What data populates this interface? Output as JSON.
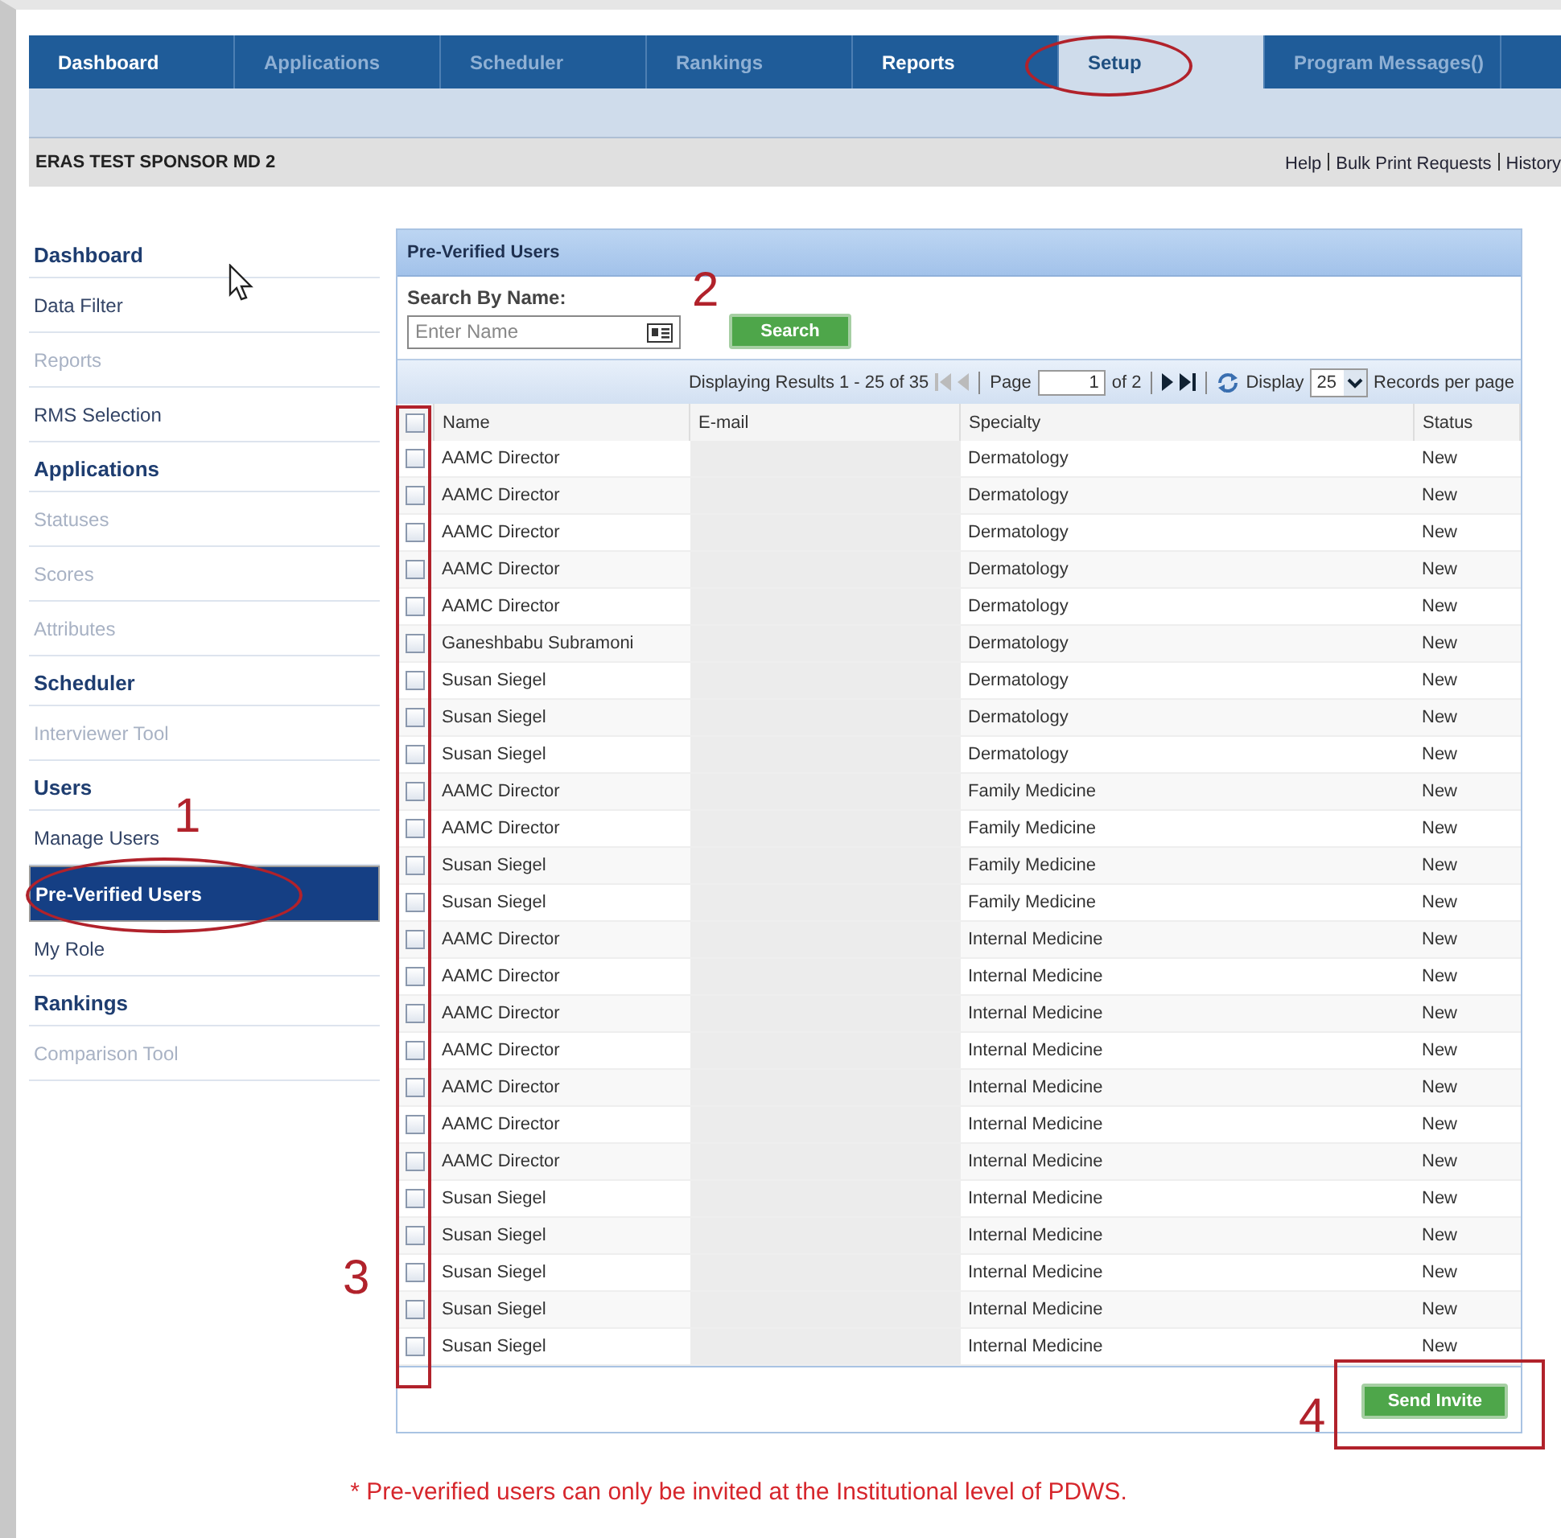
{
  "nav_tabs": [
    {
      "label": "Dashboard",
      "selected": false,
      "disabled": false
    },
    {
      "label": "Applications",
      "selected": false,
      "disabled": true
    },
    {
      "label": "Scheduler",
      "selected": false,
      "disabled": true
    },
    {
      "label": "Rankings",
      "selected": false,
      "disabled": true
    },
    {
      "label": "Reports",
      "selected": false,
      "disabled": false
    },
    {
      "label": "Setup",
      "selected": true,
      "disabled": false
    },
    {
      "label": "Program Messages()",
      "selected": false,
      "disabled": true
    }
  ],
  "account_bar": {
    "sponsor": "ERAS TEST SPONSOR MD 2",
    "links": [
      "Help",
      "Bulk Print Requests",
      "History"
    ]
  },
  "sidebar": [
    {
      "kind": "heading",
      "label": "Dashboard"
    },
    {
      "kind": "item",
      "label": "Data Filter",
      "disabled": false,
      "selected": false
    },
    {
      "kind": "item",
      "label": "Reports",
      "disabled": true,
      "selected": false
    },
    {
      "kind": "item",
      "label": "RMS Selection",
      "disabled": false,
      "selected": false
    },
    {
      "kind": "heading",
      "label": "Applications"
    },
    {
      "kind": "item",
      "label": "Statuses",
      "disabled": true,
      "selected": false
    },
    {
      "kind": "item",
      "label": "Scores",
      "disabled": true,
      "selected": false
    },
    {
      "kind": "item",
      "label": "Attributes",
      "disabled": true,
      "selected": false
    },
    {
      "kind": "heading",
      "label": "Scheduler"
    },
    {
      "kind": "item",
      "label": "Interviewer Tool",
      "disabled": true,
      "selected": false
    },
    {
      "kind": "heading",
      "label": "Users"
    },
    {
      "kind": "item",
      "label": "Manage Users",
      "disabled": false,
      "selected": false
    },
    {
      "kind": "item",
      "label": "Pre-Verified Users",
      "disabled": false,
      "selected": true
    },
    {
      "kind": "item",
      "label": "My Role",
      "disabled": false,
      "selected": false
    },
    {
      "kind": "heading",
      "label": "Rankings"
    },
    {
      "kind": "item",
      "label": "Comparison Tool",
      "disabled": true,
      "selected": false
    }
  ],
  "panel": {
    "title": "Pre-Verified Users",
    "search_label": "Search By Name:",
    "search": {
      "placeholder": "Enter Name"
    },
    "search_button": "Search",
    "pager": {
      "summary": "Displaying Results 1 - 25 of 35",
      "page_label": "Page",
      "page": "1",
      "of": "of 2",
      "display_label": "Display",
      "per_page": "25",
      "per_page_label": "Records per page"
    },
    "columns": [
      "Name",
      "E-mail",
      "Specialty",
      "Status"
    ],
    "select_all": {
      "checked": false
    },
    "rows": [
      {
        "name": "AAMC Director",
        "specialty": "Dermatology",
        "status": "New",
        "checked": false
      },
      {
        "name": "AAMC Director",
        "specialty": "Dermatology",
        "status": "New",
        "checked": false
      },
      {
        "name": "AAMC Director",
        "specialty": "Dermatology",
        "status": "New",
        "checked": false
      },
      {
        "name": "AAMC Director",
        "specialty": "Dermatology",
        "status": "New",
        "checked": false
      },
      {
        "name": "AAMC Director",
        "specialty": "Dermatology",
        "status": "New",
        "checked": false
      },
      {
        "name": "Ganeshbabu Subramoni",
        "specialty": "Dermatology",
        "status": "New",
        "checked": false
      },
      {
        "name": "Susan Siegel",
        "specialty": "Dermatology",
        "status": "New",
        "checked": false
      },
      {
        "name": "Susan Siegel",
        "specialty": "Dermatology",
        "status": "New",
        "checked": false
      },
      {
        "name": "Susan Siegel",
        "specialty": "Dermatology",
        "status": "New",
        "checked": false
      },
      {
        "name": "AAMC Director",
        "specialty": "Family Medicine",
        "status": "New",
        "checked": false
      },
      {
        "name": "AAMC Director",
        "specialty": "Family Medicine",
        "status": "New",
        "checked": false
      },
      {
        "name": "Susan Siegel",
        "specialty": "Family Medicine",
        "status": "New",
        "checked": false
      },
      {
        "name": "Susan Siegel",
        "specialty": "Family Medicine",
        "status": "New",
        "checked": false
      },
      {
        "name": "AAMC Director",
        "specialty": "Internal Medicine",
        "status": "New",
        "checked": false
      },
      {
        "name": "AAMC Director",
        "specialty": "Internal Medicine",
        "status": "New",
        "checked": false
      },
      {
        "name": "AAMC Director",
        "specialty": "Internal Medicine",
        "status": "New",
        "checked": false
      },
      {
        "name": "AAMC Director",
        "specialty": "Internal Medicine",
        "status": "New",
        "checked": false
      },
      {
        "name": "AAMC Director",
        "specialty": "Internal Medicine",
        "status": "New",
        "checked": false
      },
      {
        "name": "AAMC Director",
        "specialty": "Internal Medicine",
        "status": "New",
        "checked": false
      },
      {
        "name": "AAMC Director",
        "specialty": "Internal Medicine",
        "status": "New",
        "checked": false
      },
      {
        "name": "Susan Siegel",
        "specialty": "Internal Medicine",
        "status": "New",
        "checked": false
      },
      {
        "name": "Susan Siegel",
        "specialty": "Internal Medicine",
        "status": "New",
        "checked": false
      },
      {
        "name": "Susan Siegel",
        "specialty": "Internal Medicine",
        "status": "New",
        "checked": false
      },
      {
        "name": "Susan Siegel",
        "specialty": "Internal Medicine",
        "status": "New",
        "checked": false
      },
      {
        "name": "Susan Siegel",
        "specialty": "Internal Medicine",
        "status": "New",
        "checked": false
      }
    ],
    "send_button": "Send Invite"
  },
  "annotations": [
    "1",
    "2",
    "3",
    "4"
  ],
  "footnote": "* Pre-verified users can only be invited at the Institutional level of PDWS."
}
